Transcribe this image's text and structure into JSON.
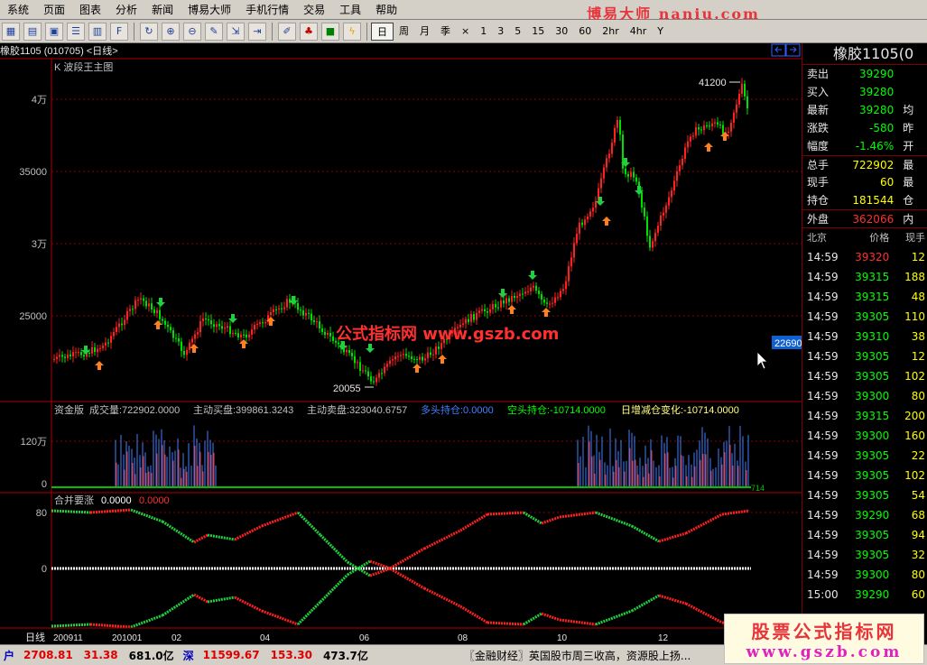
{
  "menu": {
    "items": [
      "系统",
      "页面",
      "图表",
      "分析",
      "新闻",
      "博易大师",
      "手机行情",
      "交易",
      "工具",
      "帮助"
    ],
    "brand": "博易大师 naniu.com"
  },
  "toolbar": {
    "periods": [
      "日",
      "周",
      "月",
      "季",
      "×",
      "1",
      "3",
      "5",
      "15",
      "30",
      "60",
      "2hr",
      "4hr",
      "Y"
    ],
    "active_period": "日"
  },
  "chart": {
    "title": "橡胶1105 (010705) <日线>",
    "main_label": "K  波段王主图",
    "price_ticks": [
      "4万",
      "35000",
      "3万",
      "25000"
    ],
    "high_label": "41200",
    "low_label": "20055",
    "cursor_price": "22690",
    "watermark": "公式指标网  www.gszb.com",
    "vol_panel": {
      "name": "资金版",
      "vol": "成交量:722902.0000",
      "buy": "主动买盘:399861.3243",
      "sell": "主动卖盘:323040.6757",
      "long": "多头持仓:0.0000",
      "short": "空头持仓:-10714.0000",
      "chg": "日增减仓变化:-10714.0000",
      "tick_top": "120万",
      "tick_zero": "0",
      "end_label": "714"
    },
    "osc_panel": {
      "name": "合并要涨",
      "v1": "0.0000",
      "v2": "0.0000",
      "tick_top": "80",
      "tick_zero": "0"
    },
    "xaxis": {
      "label": "日线",
      "ticks": [
        "200911",
        "201001",
        "02",
        "04",
        "06",
        "08",
        "10",
        "12"
      ]
    }
  },
  "quote": {
    "title": "橡胶1105(0",
    "rows": [
      {
        "label": "卖出",
        "value": "39290",
        "color": "#00ff00",
        "ext": ""
      },
      {
        "label": "买入",
        "value": "39280",
        "color": "#00ff00",
        "ext": ""
      },
      {
        "label": "最新",
        "value": "39280",
        "color": "#00ff00",
        "ext": "均"
      },
      {
        "label": "涨跌",
        "value": "-580",
        "color": "#00ff00",
        "ext": "昨"
      },
      {
        "label": "幅度",
        "value": "-1.46%",
        "color": "#00ff00",
        "ext": "开"
      },
      {
        "label": "总手",
        "value": "722902",
        "color": "#ffff00",
        "ext": "最"
      },
      {
        "label": "现手",
        "value": "60",
        "color": "#ffff00",
        "ext": "最"
      },
      {
        "label": "持仓",
        "value": "181544",
        "color": "#ffff00",
        "ext": "仓"
      },
      {
        "label": "外盘",
        "value": "362066",
        "color": "#ff3030",
        "ext": "内"
      }
    ],
    "tick_header": {
      "place": "北京",
      "price": "价格",
      "vol": "现手"
    },
    "ticks": [
      {
        "time": "14:59",
        "price": "39320",
        "vol": "12",
        "color": "#ff3030"
      },
      {
        "time": "14:59",
        "price": "39315",
        "vol": "188",
        "color": "#00ff00"
      },
      {
        "time": "14:59",
        "price": "39315",
        "vol": "48",
        "color": "#00ff00"
      },
      {
        "time": "14:59",
        "price": "39305",
        "vol": "110",
        "color": "#00ff00"
      },
      {
        "time": "14:59",
        "price": "39310",
        "vol": "38",
        "color": "#00ff00"
      },
      {
        "time": "14:59",
        "price": "39305",
        "vol": "12",
        "color": "#00ff00"
      },
      {
        "time": "14:59",
        "price": "39305",
        "vol": "102",
        "color": "#00ff00"
      },
      {
        "time": "14:59",
        "price": "39300",
        "vol": "80",
        "color": "#00ff00"
      },
      {
        "time": "14:59",
        "price": "39315",
        "vol": "200",
        "color": "#00ff00"
      },
      {
        "time": "14:59",
        "price": "39300",
        "vol": "160",
        "color": "#00ff00"
      },
      {
        "time": "14:59",
        "price": "39305",
        "vol": "22",
        "color": "#00ff00"
      },
      {
        "time": "14:59",
        "price": "39305",
        "vol": "102",
        "color": "#00ff00"
      },
      {
        "time": "14:59",
        "price": "39305",
        "vol": "54",
        "color": "#00ff00"
      },
      {
        "time": "14:59",
        "price": "39290",
        "vol": "68",
        "color": "#00ff00"
      },
      {
        "time": "14:59",
        "price": "39305",
        "vol": "94",
        "color": "#00ff00"
      },
      {
        "time": "14:59",
        "price": "39305",
        "vol": "32",
        "color": "#00ff00"
      },
      {
        "time": "14:59",
        "price": "39300",
        "vol": "80",
        "color": "#00ff00"
      },
      {
        "time": "15:00",
        "price": "39290",
        "vol": "60",
        "color": "#00ff00"
      }
    ]
  },
  "status": {
    "sh_label": "户",
    "sh_index": "2708.81",
    "sh_chg": "31.38",
    "sh_amt": "681.0亿",
    "sz_label": "深",
    "sz_index": "11599.67",
    "sz_chg": "153.30",
    "sz_amt": "473.7亿",
    "news": "〖金融财经〗英国股市周三收高，资源股上扬..."
  },
  "ad": {
    "line1": "股票公式指标网",
    "line2": "www.gszb.com"
  },
  "colors": {
    "up": "#ff2020",
    "down": "#00e000",
    "grid": "#8b0000",
    "panel_border": "#b00000"
  }
}
